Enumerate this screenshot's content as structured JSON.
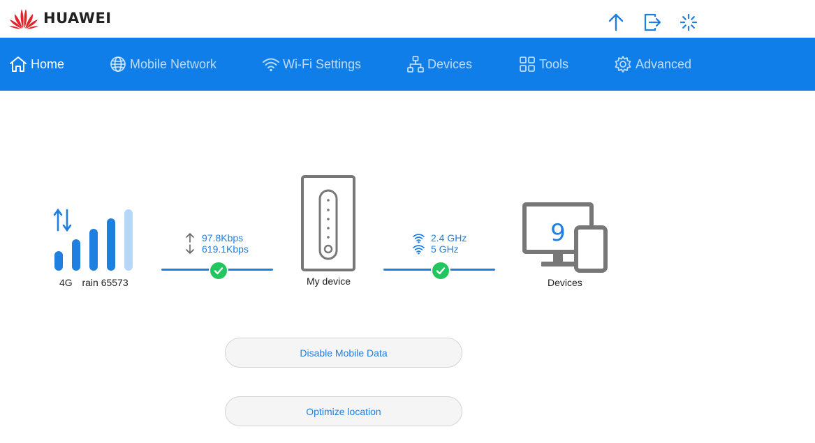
{
  "brand": {
    "name": "HUAWEI",
    "color": "#e0242b"
  },
  "top_icons": [
    "upload-arrow-icon",
    "logout-icon",
    "loading-spinner-icon"
  ],
  "nav": {
    "color": "#0f7ee8",
    "items": [
      {
        "label": "Home",
        "icon": "home-icon",
        "active": true
      },
      {
        "label": "Mobile Network",
        "icon": "globe-icon",
        "active": false
      },
      {
        "label": "Wi-Fi Settings",
        "icon": "wifi-icon",
        "active": false
      },
      {
        "label": "Devices",
        "icon": "network-tree-icon",
        "active": false
      },
      {
        "label": "Tools",
        "icon": "grid-icon",
        "active": false
      },
      {
        "label": "Advanced",
        "icon": "gear-icon",
        "active": false
      }
    ]
  },
  "status": {
    "network_type": "4G",
    "operator": "rain 65573",
    "upload_rate": "97.8Kbps",
    "download_rate": "619.1Kbps",
    "my_device_label": "My device",
    "wifi_bands": [
      "2.4 GHz",
      "5 GHz"
    ],
    "connected_devices_count": "9",
    "devices_label": "Devices"
  },
  "actions": {
    "disable_mobile_data": "Disable Mobile Data",
    "optimize_location": "Optimize location"
  }
}
